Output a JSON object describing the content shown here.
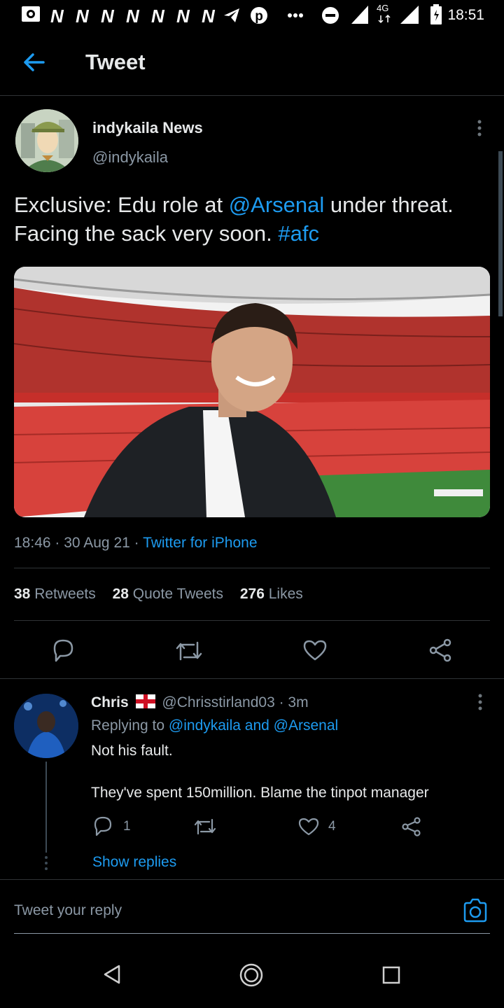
{
  "status_bar": {
    "time": "18:51",
    "network": "4G",
    "notification_icons": [
      "camera-icon",
      "n-icon",
      "n-icon",
      "n-icon",
      "n-icon",
      "n-icon",
      "n-icon",
      "n-icon",
      "telegram-icon",
      "pinterest-icon",
      "more-icon"
    ],
    "n_letter": "N"
  },
  "header": {
    "title": "Tweet"
  },
  "tweet": {
    "display_name": "indykaila News",
    "handle": "@indykaila",
    "text_before": "Exclusive: Edu role at ",
    "mention": "@Arsenal",
    "text_middle": " under threat. Facing the sack very soon. ",
    "hashtag": "#afc",
    "timestamp": "18:46 · 30 Aug 21 · ",
    "source": "Twitter for iPhone",
    "retweets_count": "38",
    "retweets_label": "Retweets",
    "quotes_count": "28",
    "quotes_label": "Quote Tweets",
    "likes_count": "276",
    "likes_label": "Likes"
  },
  "reply": {
    "name": "Chris",
    "flag": "england-flag",
    "handle_time": "@Chrisstirland03 · 3m",
    "replying_prefix": "Replying to ",
    "replying_to": "@indykaila and @Arsenal",
    "line1": "Not his fault.",
    "line2": "They've spent 150million. Blame the tinpot manager",
    "reply_count": "1",
    "like_count": "4",
    "show_replies": "Show replies"
  },
  "compose": {
    "placeholder": "Tweet your reply"
  },
  "colors": {
    "accent": "#1d9bf0",
    "background": "#000000",
    "divider": "#2f3336"
  }
}
